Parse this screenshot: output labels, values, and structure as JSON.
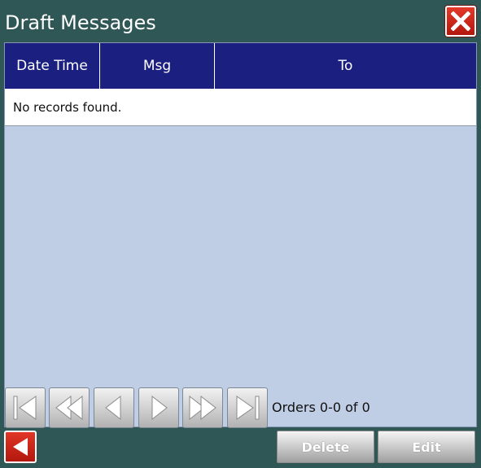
{
  "window": {
    "title": "Draft Messages"
  },
  "table": {
    "columns": [
      "Date Time",
      "Msg",
      "To"
    ],
    "empty_message": "No records found."
  },
  "pager": {
    "status": "Orders 0-0 of 0"
  },
  "actions": {
    "delete_label": "Delete",
    "edit_label": "Edit"
  },
  "icons": {
    "close": "close-icon",
    "first": "first-page-icon",
    "fast_back": "fast-back-icon",
    "prev": "previous-icon",
    "next": "next-icon",
    "fast_forward": "fast-forward-icon",
    "last": "last-page-icon",
    "back": "back-arrow-icon"
  },
  "colors": {
    "background": "#2f5755",
    "header": "#1a1f80",
    "panel": "#bfcde5",
    "close_red": "#d22a1c"
  }
}
